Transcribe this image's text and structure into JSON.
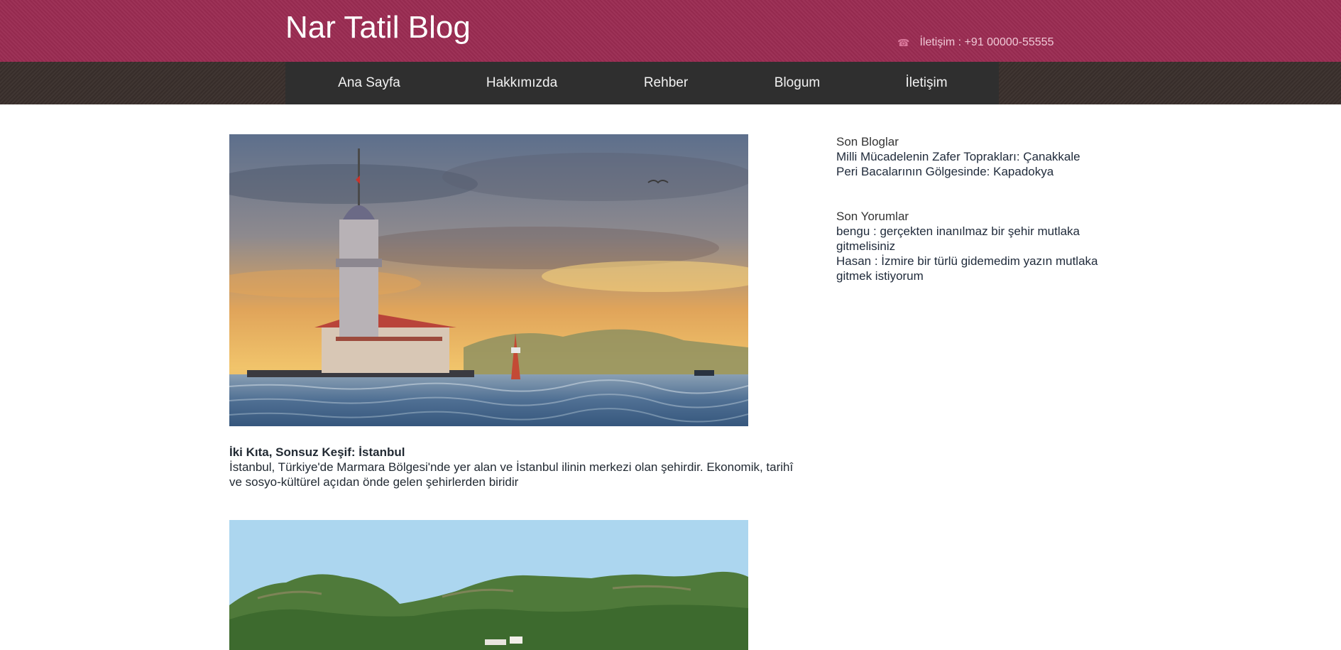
{
  "header": {
    "title": "Nar Tatil Blog",
    "contact_icon": "telephone-icon",
    "contact": "İletişim : +91 00000-55555",
    "colors": {
      "topbar": "#9a2c52",
      "navbar": "#2f2f2f",
      "navstrip": "#3a2f2c"
    }
  },
  "nav": {
    "items": [
      {
        "label": "Ana Sayfa"
      },
      {
        "label": "Hakkımızda"
      },
      {
        "label": "Rehber"
      },
      {
        "label": "Blogum"
      },
      {
        "label": "İletişim"
      }
    ]
  },
  "posts": [
    {
      "title": "İki Kıta, Sonsuz Keşif: İstanbul",
      "text": "İstanbul, Türkiye'de Marmara Bölgesi'nde yer alan ve İstanbul ilinin merkezi olan şehirdir. Ekonomik, tarihî ve sosyo-kültürel açıdan önde gelen şehirlerden biridir"
    }
  ],
  "sidebar": {
    "recent_heading": "Son Bloglar",
    "recent_posts": [
      "Milli Mücadelenin Zafer Toprakları: Çanakkale",
      "Peri Bacalarının Gölgesinde: Kapadokya"
    ],
    "comments_heading": "Son Yorumlar",
    "comments": [
      "bengu : gerçekten inanılmaz bir şehir mutlaka gitmelisiniz",
      "Hasan : İzmire bir türlü gidemedim yazın mutlaka gitmek istiyorum"
    ]
  }
}
